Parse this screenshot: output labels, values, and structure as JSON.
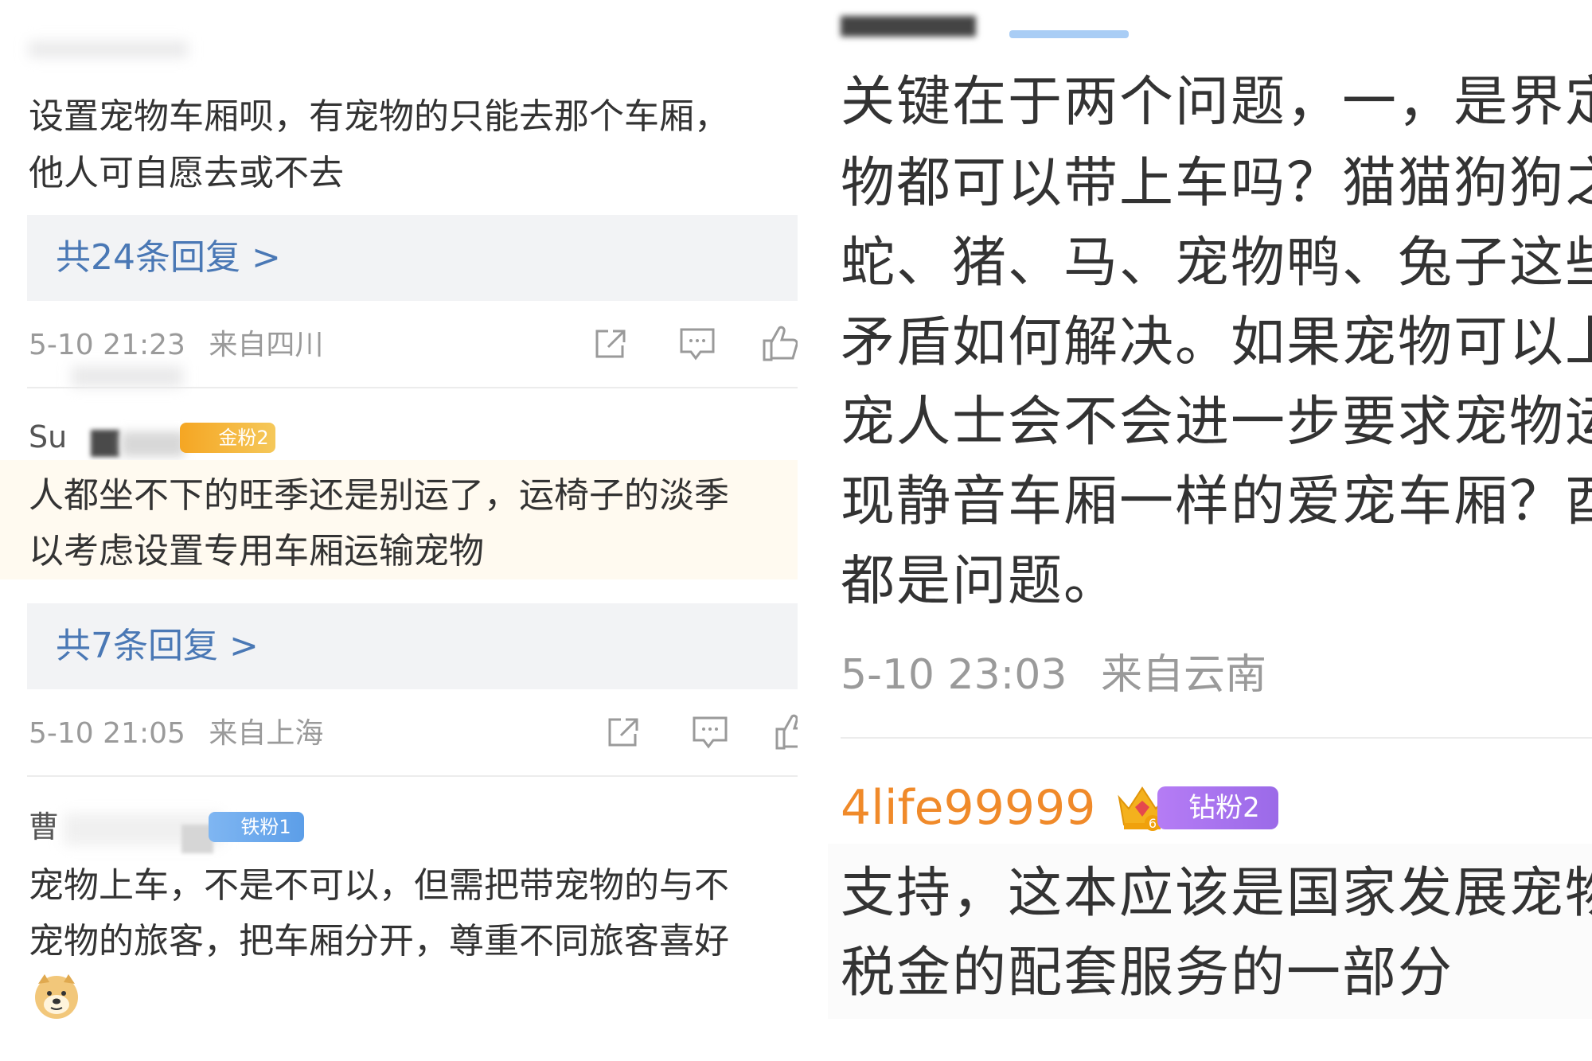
{
  "left": {
    "comment1": {
      "text_line1": "设置宠物车厢呗，有宠物的只能去那个车厢，",
      "text_line2": "他人可自愿去或不去",
      "replies": "共24条回复 >",
      "timestamp": "5-10 21:23",
      "location": "来自四川"
    },
    "comment2": {
      "username": "Su",
      "badge": "金粉2",
      "text_line1": "人都坐不下的旺季还是别运了，运椅子的淡季",
      "text_line2": "以考虑设置专用车厢运输宠物",
      "replies": "共7条回复 >",
      "timestamp": "5-10 21:05",
      "location": "来自上海"
    },
    "comment3": {
      "username": "曹",
      "badge": "铁粉1",
      "text_line1": "宠物上车，不是不可以，但需把带宠物的与不",
      "text_line2": "宠物的旅客，把车厢分开，尊重不同旅客喜好",
      "emoji": "doge-emoji"
    }
  },
  "right": {
    "comment1": {
      "lines": [
        "关键在于两个问题，一，是界定",
        "物都可以带上车吗？猫猫狗狗之",
        "蛇、猪、马、宠物鸭、兔子这些",
        "矛盾如何解决。如果宠物可以上",
        "宠人士会不会进一步要求宠物运",
        "现静音车厢一样的爱宠车厢？酉",
        "都是问题。"
      ],
      "timestamp": "5-10 23:03",
      "location": "来自云南"
    },
    "comment2": {
      "username": "4life99999",
      "badge": "钻粉2",
      "crown_level": "6",
      "text_line1": "支持，这本应该是国家发展宠物",
      "text_line2": "税金的配套服务的一部分"
    }
  },
  "icons": [
    "share-icon",
    "comment-icon",
    "like-icon",
    "crown-icon",
    "doge-emoji"
  ],
  "colors": {
    "link_blue": "#4a78b5",
    "meta_gray": "#9a9a9a",
    "username_orange": "#f08a2a",
    "badge_gold": "#f5b43b",
    "badge_blue": "#6aa8f0",
    "badge_purple": "#a86ff0"
  }
}
